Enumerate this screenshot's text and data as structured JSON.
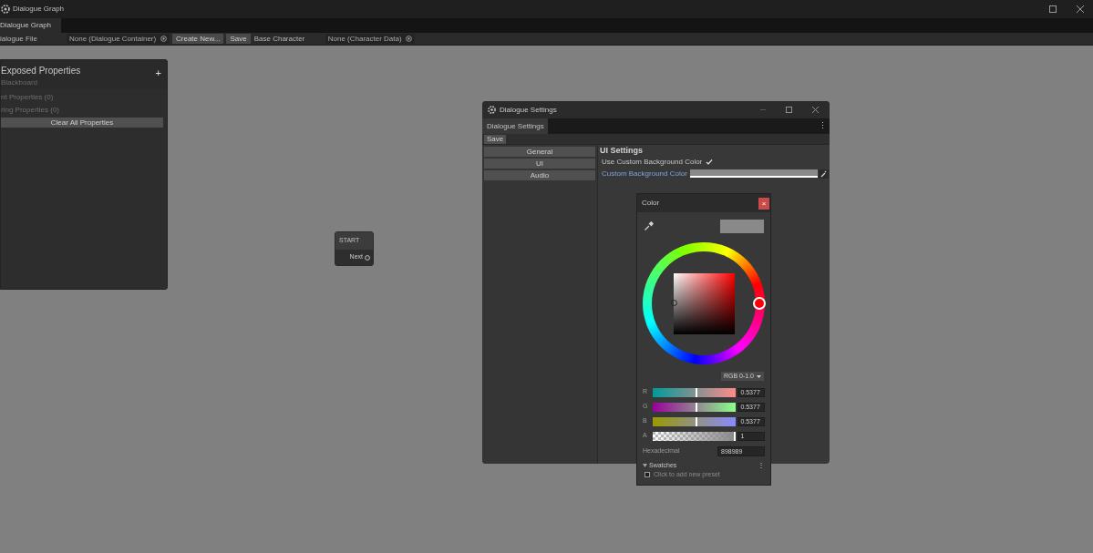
{
  "window": {
    "title": "Dialogue Graph"
  },
  "tabs": [
    {
      "label": "Dialogue Graph",
      "selected": true
    }
  ],
  "toolbar": {
    "file_label": "ialogue File",
    "file_field": "None (Dialogue Container)",
    "create_button": "Create New...",
    "save_button": "Save",
    "character_label": "Base Character",
    "character_field": "None (Character Data)"
  },
  "blackboard": {
    "title": "Exposed Properties",
    "subtitle": "Blackboard",
    "add_button": "+",
    "sections": [
      "nt Properties (0)",
      "ring Properties (0)"
    ],
    "clear_button": "Clear All Properties"
  },
  "node": {
    "title": "START",
    "port": "Next"
  },
  "settings_window": {
    "title": "Dialogue Settings",
    "tab": {
      "label": "Dialogue Settings",
      "selected": true
    },
    "menu_button": "⋮",
    "save_button": "Save",
    "categories": [
      {
        "label": "General"
      },
      {
        "label": "UI"
      },
      {
        "label": "Audio"
      }
    ],
    "section_title": "UI Settings",
    "fields": [
      {
        "kind": "checkbox",
        "label": "Use Custom Background Color",
        "checked": true
      },
      {
        "kind": "color",
        "label": "Custom Background Color",
        "color": "#898989"
      }
    ]
  },
  "color_picker": {
    "title": "Color",
    "close_button": "×",
    "mode": "RGB 0-1.0",
    "channels": [
      {
        "name": "R",
        "level": 0.5377,
        "value": "0.5377",
        "kind": "r"
      },
      {
        "name": "G",
        "level": 0.5377,
        "value": "0.5377",
        "kind": "g"
      },
      {
        "name": "B",
        "level": 0.5377,
        "value": "0.5377",
        "kind": "b"
      },
      {
        "name": "A",
        "level": 1,
        "value": "1",
        "kind": "a"
      }
    ],
    "hex_label": "Hexadecimal",
    "hex_value": "898989",
    "swatches_label": "Swatches",
    "swatches_hint": "Click to add new preset",
    "swatches_menu": "⋮"
  }
}
